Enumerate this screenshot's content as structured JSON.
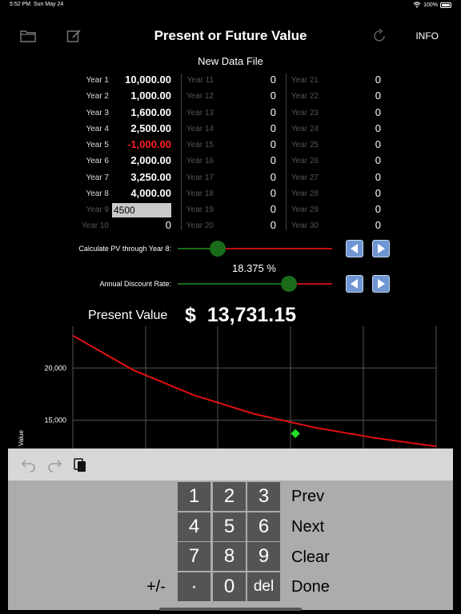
{
  "status": {
    "time": "5:52 PM",
    "date": "Sun May 24",
    "battery": "100%"
  },
  "nav": {
    "title": "Present or Future Value",
    "info": "INFO"
  },
  "file_title": "New Data File",
  "years": [
    {
      "label": "Year 1",
      "value": "10,000.00"
    },
    {
      "label": "Year 2",
      "value": "1,000.00"
    },
    {
      "label": "Year 3",
      "value": "1,600.00"
    },
    {
      "label": "Year 4",
      "value": "2,500.00"
    },
    {
      "label": "Year 5",
      "value": "-1,000.00"
    },
    {
      "label": "Year 6",
      "value": "2,000.00"
    },
    {
      "label": "Year 7",
      "value": "3,250.00"
    },
    {
      "label": "Year 8",
      "value": "4,000.00"
    },
    {
      "label": "Year 9",
      "value": "4500"
    },
    {
      "label": "Year 10",
      "value": "0"
    },
    {
      "label": "Year 11",
      "value": "0"
    },
    {
      "label": "Year 12",
      "value": "0"
    },
    {
      "label": "Year 13",
      "value": "0"
    },
    {
      "label": "Year 14",
      "value": "0"
    },
    {
      "label": "Year 15",
      "value": "0"
    },
    {
      "label": "Year 16",
      "value": "0"
    },
    {
      "label": "Year 17",
      "value": "0"
    },
    {
      "label": "Year 18",
      "value": "0"
    },
    {
      "label": "Year 19",
      "value": "0"
    },
    {
      "label": "Year 20",
      "value": "0"
    },
    {
      "label": "Year 21",
      "value": "0"
    },
    {
      "label": "Year 22",
      "value": "0"
    },
    {
      "label": "Year 23",
      "value": "0"
    },
    {
      "label": "Year 24",
      "value": "0"
    },
    {
      "label": "Year 25",
      "value": "0"
    },
    {
      "label": "Year 26",
      "value": "0"
    },
    {
      "label": "Year 27",
      "value": "0"
    },
    {
      "label": "Year 28",
      "value": "0"
    },
    {
      "label": "Year 29",
      "value": "0"
    },
    {
      "label": "Year 30",
      "value": "0"
    }
  ],
  "sliders": {
    "years_label": "Calculate PV through Year 8:",
    "years_level": 8,
    "years_max": 30,
    "rate_label": "Annual Discount Rate:",
    "rate_value": "18.375 %",
    "rate_level": 0.72
  },
  "result": {
    "label": "Present Value",
    "currency": "$",
    "value": "13,731.15"
  },
  "chart_data": {
    "type": "line",
    "ylabel": "Value",
    "yticks": [
      "20,000",
      "15,000"
    ],
    "x": [
      0,
      0.05,
      0.1,
      0.15,
      0.2,
      0.25,
      0.3
    ],
    "values": [
      23100,
      19800,
      17400,
      15600,
      14300,
      13300,
      12500
    ],
    "highlight": {
      "x": 0.18375,
      "y": 13731.15
    },
    "ylim": [
      11000,
      24000
    ],
    "xlim": [
      0,
      0.3
    ],
    "grid": true,
    "line_color": "#e01010",
    "marker_color": "#22dd22"
  },
  "keypad": {
    "digits": [
      "1",
      "2",
      "3",
      "4",
      "5",
      "6",
      "7",
      "8",
      "9",
      "·",
      "0",
      "del"
    ],
    "sign": "+/-",
    "prev": "Prev",
    "next": "Next",
    "clear": "Clear",
    "done": "Done"
  },
  "colors": {
    "negative": "#ff2020",
    "slider_active": "#1a6b1a",
    "slider_inactive": "#c01010",
    "button_blue": "#6d96d2"
  }
}
